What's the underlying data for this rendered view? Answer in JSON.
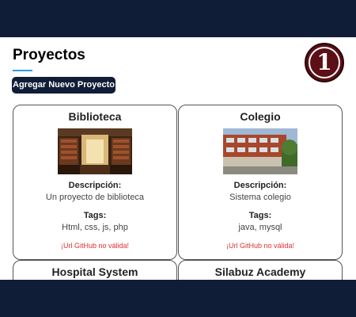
{
  "header": {
    "title": "Proyectos",
    "add_button": "Agregar Nuevo Proyecto",
    "logo_text": "1"
  },
  "colors": {
    "navbar": "#0f1d37",
    "accent_underline": "#2d9cdb",
    "logo": "#5c0f16",
    "error": "#e03030"
  },
  "projects": [
    {
      "title": "Biblioteca",
      "desc_label": "Descripción:",
      "description": "Un proyecto de biblioteca",
      "tags_label": "Tags:",
      "tags": "Html, css, js, php",
      "url_error": "¡Url GitHub no válida!"
    },
    {
      "title": "Colegio",
      "desc_label": "Descripción:",
      "description": "Sistema colegio",
      "tags_label": "Tags:",
      "tags": "java, mysql",
      "url_error": "¡Url GitHub no válida!"
    },
    {
      "title": "Hospital System"
    },
    {
      "title": "Silabuz Academy"
    }
  ]
}
